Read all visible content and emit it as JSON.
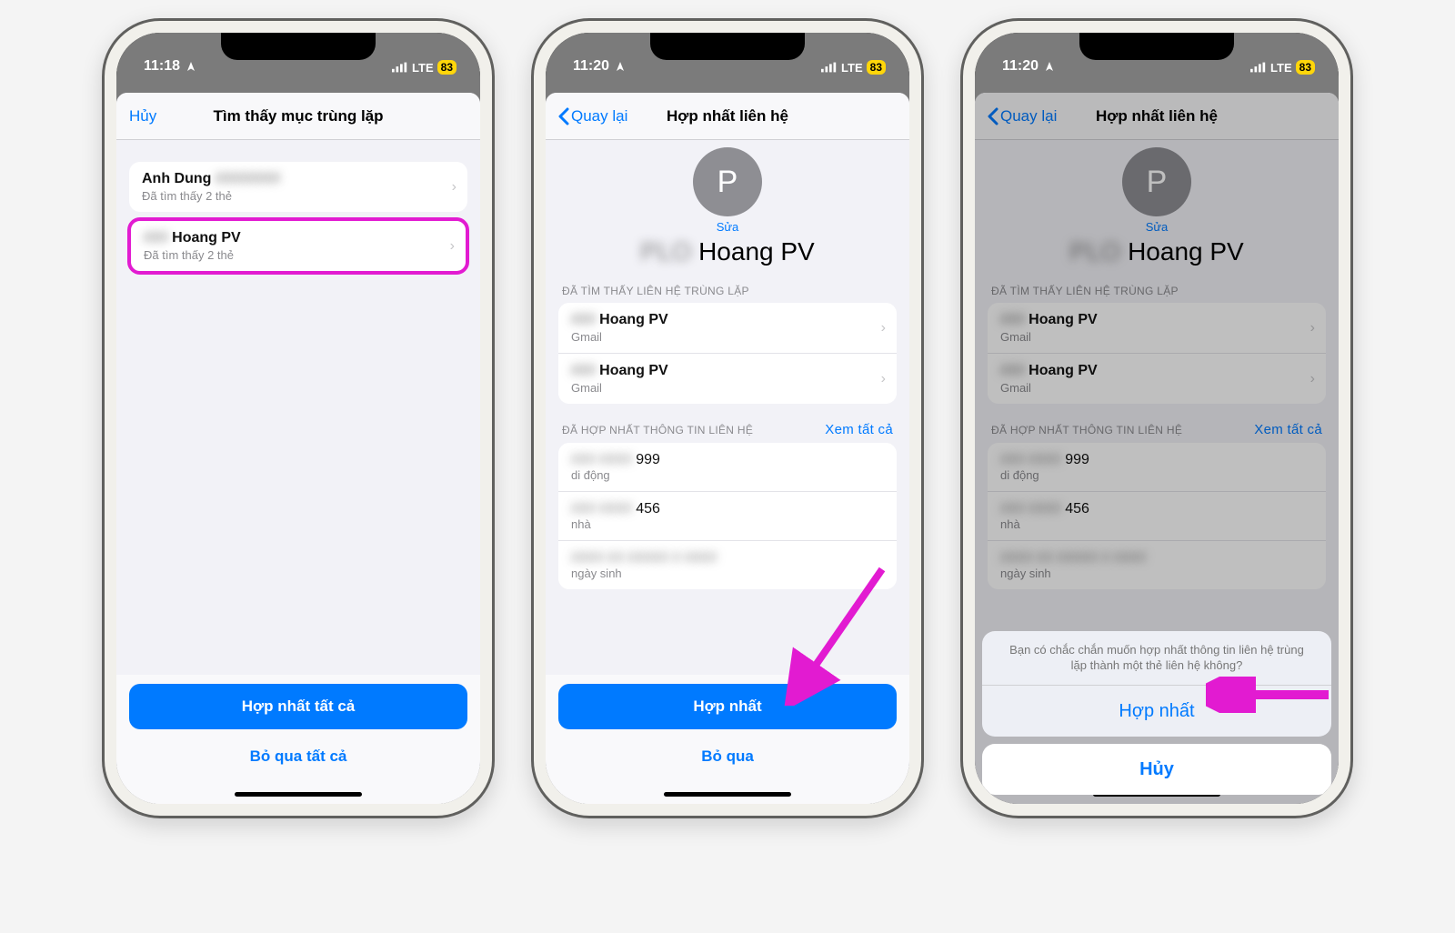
{
  "phones": [
    {
      "status": {
        "time": "11:18",
        "net": "LTE",
        "battery": "83"
      },
      "nav": {
        "left": "Hủy",
        "title": "Tìm thấy mục trùng lặp"
      },
      "duplicates": [
        {
          "name": "Anh Dung",
          "sub": "Đã tìm thấy 2 thẻ"
        },
        {
          "name": "Hoang PV",
          "sub": "Đã tìm thấy 2 thẻ"
        }
      ],
      "footer": {
        "primary": "Hợp nhất tất cả",
        "secondary": "Bỏ qua tất cả"
      }
    },
    {
      "status": {
        "time": "11:20",
        "net": "LTE",
        "battery": "83"
      },
      "nav": {
        "left": "Quay lại",
        "title": "Hợp nhất liên hệ"
      },
      "contact": {
        "initial": "P",
        "edit": "Sửa",
        "name": "Hoang PV",
        "sectionDup": "ĐÃ TÌM THẤY LIÊN HỆ TRÙNG LẶP",
        "dups": [
          {
            "name": "Hoang PV",
            "src": "Gmail"
          },
          {
            "name": "Hoang PV",
            "src": "Gmail"
          }
        ],
        "sectionMerged": "ĐÃ HỢP NHẤT THÔNG TIN LIÊN HỆ",
        "seeAll": "Xem tất cả",
        "info": [
          {
            "value": "999",
            "label": "di động"
          },
          {
            "value": "456",
            "label": "nhà"
          },
          {
            "value": "",
            "label": "ngày sinh"
          }
        ]
      },
      "footer": {
        "primary": "Hợp nhất",
        "secondary": "Bỏ qua"
      }
    },
    {
      "status": {
        "time": "11:20",
        "net": "LTE",
        "battery": "83"
      },
      "nav": {
        "left": "Quay lại",
        "title": "Hợp nhất liên hệ"
      },
      "contact": {
        "initial": "P",
        "edit": "Sửa",
        "name": "Hoang PV",
        "sectionDup": "ĐÃ TÌM THẤY LIÊN HỆ TRÙNG LẶP",
        "dups": [
          {
            "name": "Hoang PV",
            "src": "Gmail"
          },
          {
            "name": "Hoang PV",
            "src": "Gmail"
          }
        ],
        "sectionMerged": "ĐÃ HỢP NHẤT THÔNG TIN LIÊN HỆ",
        "seeAll": "Xem tất cả",
        "info": [
          {
            "value": "999",
            "label": "di động"
          },
          {
            "value": "456",
            "label": "nhà"
          },
          {
            "value": "",
            "label": "ngày sinh"
          }
        ]
      },
      "actionSheet": {
        "message": "Bạn có chắc chắn muốn hợp nhất thông tin liên hệ trùng lặp thành một thẻ liên hệ không?",
        "confirm": "Hợp nhất",
        "cancel": "Hủy"
      }
    }
  ]
}
